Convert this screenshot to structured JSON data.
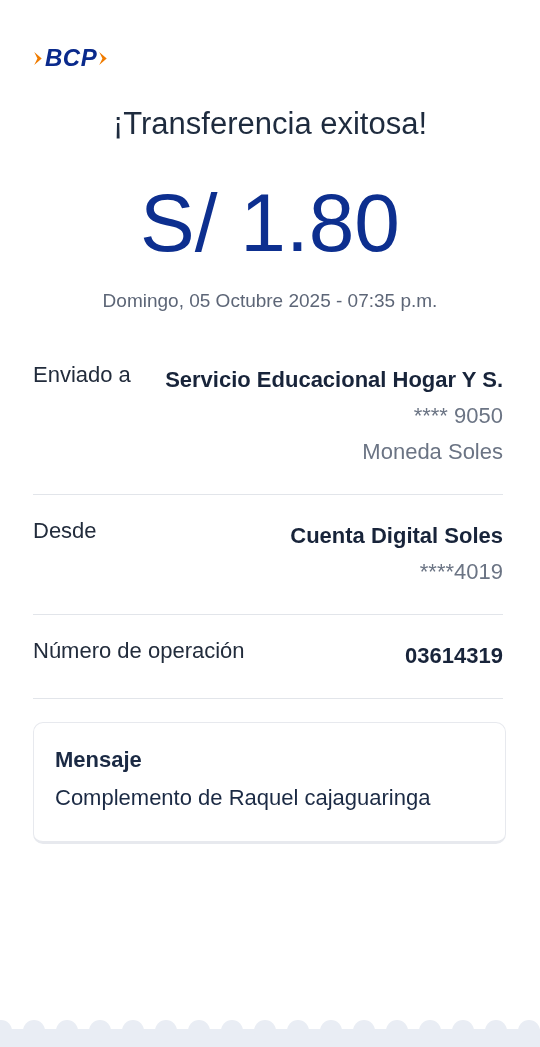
{
  "logo": {
    "text": "BCP"
  },
  "title": "¡Transferencia exitosa!",
  "amount": "S/ 1.80",
  "datetime": "Domingo, 05 Octubre 2025 - 07:35 p.m.",
  "details": [
    {
      "label": "Enviado a",
      "values": [
        {
          "kind": "strong",
          "text": "Servicio Educacional Hogar Y S."
        },
        {
          "kind": "muted",
          "text": "**** 9050"
        },
        {
          "kind": "muted",
          "text": "Moneda Soles"
        }
      ]
    },
    {
      "label": "Desde",
      "values": [
        {
          "kind": "strong",
          "text": "Cuenta Digital Soles"
        },
        {
          "kind": "muted",
          "text": "****4019"
        }
      ]
    },
    {
      "label": "Número de operación",
      "values": [
        {
          "kind": "strong",
          "text": "03614319"
        }
      ]
    }
  ],
  "message": {
    "heading": "Mensaje",
    "text": "Complemento de Raquel cajaguaringa"
  }
}
